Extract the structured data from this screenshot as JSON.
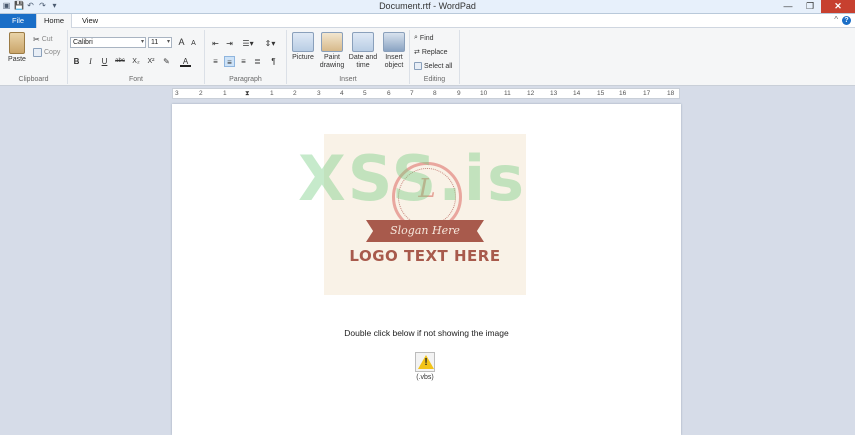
{
  "window": {
    "title": "Document.rtf - WordPad",
    "min": "—",
    "max": "❐",
    "close": "✕"
  },
  "qat": [
    "▣",
    "💾",
    "↶",
    "↷",
    "▾"
  ],
  "tabs": {
    "file": "File",
    "home": "Home",
    "view": "View",
    "collapse": "^",
    "help": "?"
  },
  "clipboard": {
    "paste": "Paste",
    "cut": "Cut",
    "copy": "Copy",
    "label": "Clipboard"
  },
  "font": {
    "family": "Calibri",
    "size": "11",
    "grow": "A",
    "shrink": "A",
    "bold": "B",
    "italic": "I",
    "underline": "U",
    "strike": "abc",
    "sub": "X₂",
    "sup": "X²",
    "highlight": "✎",
    "color": "A",
    "label": "Font"
  },
  "paragraph": {
    "label": "Paragraph"
  },
  "insert": {
    "picture": "Picture",
    "paint": "Paint drawing",
    "datetime": "Date and time",
    "object": "Insert object",
    "label": "Insert"
  },
  "editing": {
    "find": "Find",
    "replace": "Replace",
    "selectall": "Select all",
    "label": "Editing"
  },
  "ruler": [
    "3",
    "2",
    "1",
    "1",
    "2",
    "3",
    "4",
    "5",
    "6",
    "7",
    "8",
    "9",
    "10",
    "11",
    "12",
    "13",
    "14",
    "15",
    "16",
    "17",
    "18"
  ],
  "document": {
    "watermark": "XSS.is",
    "logo_letter": "L",
    "slogan": "Slogan Here",
    "logo_text": "LOGO TEXT HERE",
    "instruction": "Double click below if not showing the image",
    "object_label": "(.vbs)"
  }
}
